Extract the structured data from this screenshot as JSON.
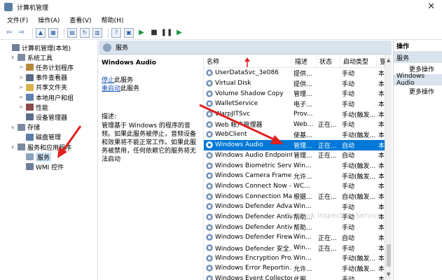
{
  "window": {
    "title": "计算机管理",
    "close_glyph": "✕"
  },
  "menu": [
    "文件(F)",
    "操作(A)",
    "查看(V)",
    "帮助(H)"
  ],
  "tree": {
    "items": [
      {
        "label": "计算机管理(本地)",
        "level": 0,
        "twisty": "",
        "icon_color": "#6b7f99"
      },
      {
        "label": "系统工具",
        "level": 1,
        "twisty": "∨",
        "icon_color": "#7a8aa0"
      },
      {
        "label": "任务计划程序",
        "level": 2,
        "twisty": ">",
        "icon_color": "#b58a3c"
      },
      {
        "label": "事件查看器",
        "level": 2,
        "twisty": ">",
        "icon_color": "#5a6b85"
      },
      {
        "label": "共享文件夹",
        "level": 2,
        "twisty": ">",
        "icon_color": "#d9b24a"
      },
      {
        "label": "本地用户和组",
        "level": 2,
        "twisty": ">",
        "icon_color": "#5e80b0"
      },
      {
        "label": "性能",
        "level": 2,
        "twisty": ">",
        "icon_color": "#8c4a4a"
      },
      {
        "label": "设备管理器",
        "level": 2,
        "twisty": "",
        "icon_color": "#5a6e8c"
      },
      {
        "label": "存储",
        "level": 1,
        "twisty": "∨",
        "icon_color": "#7a8aa0"
      },
      {
        "label": "磁盘管理",
        "level": 2,
        "twisty": "",
        "icon_color": "#5a7da8"
      },
      {
        "label": "服务和应用程序",
        "level": 1,
        "twisty": "∨",
        "icon_color": "#7a8aa0"
      },
      {
        "label": "服务",
        "level": 2,
        "twisty": "",
        "icon_color": "#8ba2bd",
        "selected": true
      },
      {
        "label": "WMI 控件",
        "level": 2,
        "twisty": "",
        "icon_color": "#6b7f99"
      }
    ]
  },
  "services_panel": {
    "header": "服务",
    "selected_name": "Windows Audio",
    "link_stop_blue": "停止",
    "link_stop_rest": "此服务",
    "link_restart_blue": "重启动",
    "link_restart_rest": "此服务",
    "description_label": "描述:",
    "description": "管理基于 Windows 的程序的音频。如果此服务被停止，音频设备和效果将不能正常工作。如果此服务被禁用，任何依赖它的服务将无法启动"
  },
  "list": {
    "columns": {
      "name": "名称",
      "desc": "描述",
      "status": "状态",
      "startup": "启动类型",
      "login": "登"
    },
    "rows": [
      {
        "name": "UserDataSvc_3e086",
        "desc": "提供...",
        "status": "",
        "startup": "手动",
        "login": "本"
      },
      {
        "name": "Virtual Disk",
        "desc": "提供...",
        "status": "",
        "startup": "手动",
        "login": "本"
      },
      {
        "name": "Volume Shadow Copy",
        "desc": "管理...",
        "status": "",
        "startup": "手动",
        "login": "本"
      },
      {
        "name": "WalletService",
        "desc": "电子...",
        "status": "",
        "startup": "手动",
        "login": "本"
      },
      {
        "name": "WarpJITSvc",
        "desc": "Prov...",
        "status": "",
        "startup": "手动(触发...",
        "login": "本"
      },
      {
        "name": "Web 帐户管理器",
        "desc": "Web...",
        "status": "正在...",
        "startup": "手动",
        "login": "本"
      },
      {
        "name": "WebClient",
        "desc": "使基...",
        "status": "",
        "startup": "手动(触发...",
        "login": "本"
      },
      {
        "name": "Windows Audio",
        "desc": "管理...",
        "status": "正在...",
        "startup": "自动",
        "login": "本",
        "selected": true
      },
      {
        "name": "Windows Audio Endpoint...",
        "desc": "管理...",
        "status": "正在...",
        "startup": "自动",
        "login": "本"
      },
      {
        "name": "Windows Biometric Servic...",
        "desc": "Win...",
        "status": "",
        "startup": "手动(触发...",
        "login": "本"
      },
      {
        "name": "Windows Camera Frame ...",
        "desc": "允许...",
        "status": "",
        "startup": "手动(触发...",
        "login": "本"
      },
      {
        "name": "Windows Connect Now - ...",
        "desc": "WC...",
        "status": "",
        "startup": "手动",
        "login": "本"
      },
      {
        "name": "Windows Connection Ma...",
        "desc": "根据...",
        "status": "正在...",
        "startup": "自动(触发...",
        "login": "本"
      },
      {
        "name": "Windows Defender Adva...",
        "desc": "Win...",
        "status": "",
        "startup": "手动",
        "login": "本"
      },
      {
        "name": "Windows Defender Antivi...",
        "desc": "帮助...",
        "status": "",
        "startup": "手动",
        "login": "本"
      },
      {
        "name": "Windows Defender Antivi...",
        "desc": "帮助...",
        "status": "",
        "startup": "手动",
        "login": "本"
      },
      {
        "name": "Windows Defender Firew...",
        "desc": "Win...",
        "status": "正在...",
        "startup": "自动",
        "login": "本"
      },
      {
        "name": "Windows Defender 安全...",
        "desc": "Win...",
        "status": "正在...",
        "startup": "手动",
        "login": "本"
      },
      {
        "name": "Windows Encryption Pro...",
        "desc": "Win...",
        "status": "",
        "startup": "手动(触发...",
        "login": "本"
      },
      {
        "name": "Windows Error Reportin...",
        "desc": "允许...",
        "status": "",
        "startup": "手动(触发...",
        "login": "本"
      },
      {
        "name": "Windows Event Collector",
        "desc": "此服...",
        "status": "",
        "startup": "手动",
        "login": "本"
      }
    ]
  },
  "actions": {
    "header": "操作",
    "section1": "服务",
    "more1": "更多操作",
    "section2": "Windows Audio",
    "more2": "更多操作"
  },
  "watermark": "Network Inspection Service",
  "colors": {
    "selection": "#0078d7",
    "annotation_arrow": "#e02020",
    "link": "#1a55b5"
  }
}
